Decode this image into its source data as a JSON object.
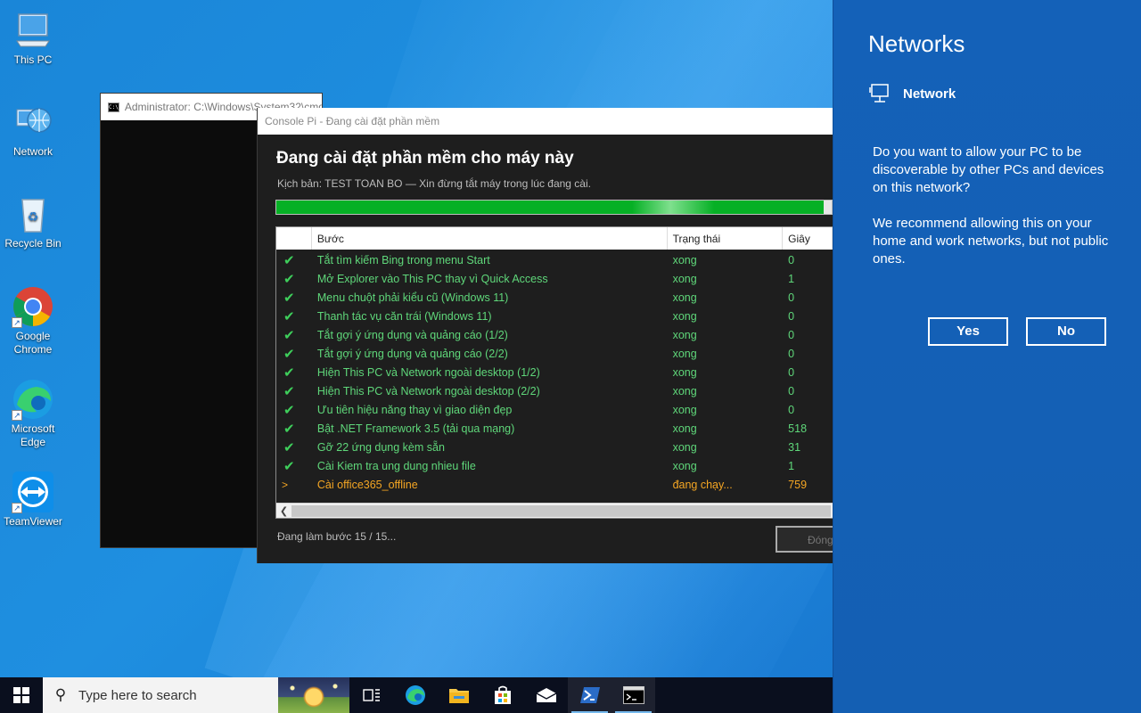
{
  "desktop": {
    "icons": [
      {
        "label": "This PC"
      },
      {
        "label": "Network"
      },
      {
        "label": "Recycle Bin"
      },
      {
        "label": "Google Chrome"
      },
      {
        "label": "Microsoft Edge"
      },
      {
        "label": "TeamViewer"
      }
    ]
  },
  "cmd_window": {
    "title": "Administrator: C:\\Windows\\System32\\cmd.exe"
  },
  "installer": {
    "window_title": "Console Pi - Đang cài đặt phần mềm",
    "heading": "Đang cài đặt phần mềm cho máy này",
    "subtitle": "Kịch bản: TEST TOAN BO   —   Xin đừng tắt máy trong lúc đang cài.",
    "progress_fraction": 0.985,
    "columns": {
      "step": "Bước",
      "status": "Trạng thái",
      "seconds": "Giây"
    },
    "rows": [
      {
        "mark": "✔",
        "step": "Tắt tìm kiếm Bing trong menu Start",
        "status": "xong",
        "seconds": "0"
      },
      {
        "mark": "✔",
        "step": "Mở Explorer vào This PC thay vì Quick Access",
        "status": "xong",
        "seconds": "1"
      },
      {
        "mark": "✔",
        "step": "Menu chuột phải kiểu cũ (Windows 11)",
        "status": "xong",
        "seconds": "0"
      },
      {
        "mark": "✔",
        "step": "Thanh tác vụ căn trái (Windows 11)",
        "status": "xong",
        "seconds": "0"
      },
      {
        "mark": "✔",
        "step": "Tắt gợi ý ứng dụng và quảng cáo (1/2)",
        "status": "xong",
        "seconds": "0"
      },
      {
        "mark": "✔",
        "step": "Tắt gợi ý ứng dụng và quảng cáo (2/2)",
        "status": "xong",
        "seconds": "0"
      },
      {
        "mark": "✔",
        "step": "Hiện This PC và Network ngoài desktop (1/2)",
        "status": "xong",
        "seconds": "0"
      },
      {
        "mark": "✔",
        "step": "Hiện This PC và Network ngoài desktop (2/2)",
        "status": "xong",
        "seconds": "0"
      },
      {
        "mark": "✔",
        "step": "Ưu tiên hiệu năng thay vì giao diện đẹp",
        "status": "xong",
        "seconds": "0"
      },
      {
        "mark": "✔",
        "step": "Bật .NET Framework 3.5 (tải qua mạng)",
        "status": "xong",
        "seconds": "518"
      },
      {
        "mark": "✔",
        "step": "Gỡ 22 ứng dụng kèm sẵn",
        "status": "xong",
        "seconds": "31"
      },
      {
        "mark": "✔",
        "step": "Cài Kiem tra ung dung nhieu file",
        "status": "xong",
        "seconds": "1"
      },
      {
        "mark": ">",
        "step": "Cài office365_offline",
        "status": "đang chạy...",
        "seconds": "759"
      }
    ],
    "footer_status": "Đang làm bước 15 / 15...",
    "close_label": "Đóng"
  },
  "networks_flyout": {
    "title": "Networks",
    "network_name": "Network",
    "question": "Do you want to allow your PC to be discoverable by other PCs and devices on this network?",
    "recommendation": "We recommend allowing this on your home and work networks, but not public ones.",
    "yes_label": "Yes",
    "no_label": "No"
  },
  "taskbar": {
    "search_placeholder": "Type here to search",
    "items": [
      "task-view-icon",
      "edge-icon",
      "file-explorer-icon",
      "store-icon",
      "mail-icon",
      "powershell-icon",
      "cmd-icon"
    ]
  },
  "colors": {
    "accent_blue": "#145fb3",
    "progress_green": "#06b025",
    "done_green": "#5fd77a",
    "running_orange": "#f5a623"
  }
}
